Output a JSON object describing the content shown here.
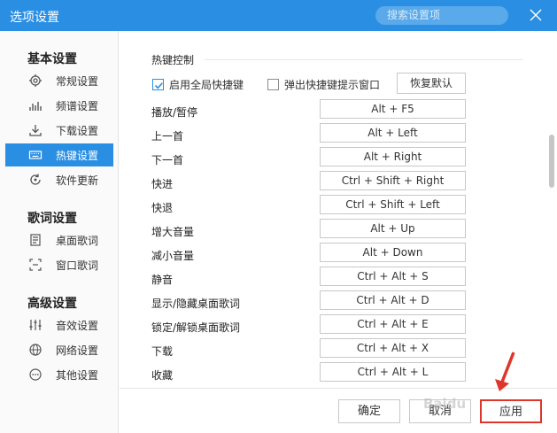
{
  "window": {
    "title": "选项设置"
  },
  "search": {
    "placeholder": "搜索设置项"
  },
  "sidebar": {
    "groups": [
      {
        "title": "基本设置",
        "items": [
          {
            "label": "常规设置",
            "icon": "gear-icon"
          },
          {
            "label": "频谱设置",
            "icon": "spectrum-icon"
          },
          {
            "label": "下载设置",
            "icon": "download-icon"
          },
          {
            "label": "热键设置",
            "icon": "keyboard-icon",
            "active": true
          },
          {
            "label": "软件更新",
            "icon": "refresh-icon"
          }
        ]
      },
      {
        "title": "歌词设置",
        "items": [
          {
            "label": "桌面歌词",
            "icon": "desktop-lyrics-icon"
          },
          {
            "label": "窗口歌词",
            "icon": "window-lyrics-icon"
          }
        ]
      },
      {
        "title": "高级设置",
        "items": [
          {
            "label": "音效设置",
            "icon": "equalizer-icon"
          },
          {
            "label": "网络设置",
            "icon": "globe-icon"
          },
          {
            "label": "其他设置",
            "icon": "more-icon"
          }
        ]
      }
    ]
  },
  "hotkeys": {
    "section_title": "热键控制",
    "enable_global_label": "启用全局快捷键",
    "enable_global_checked": true,
    "popup_hint_label": "弹出快捷键提示窗口",
    "popup_hint_checked": false,
    "restore_label": "恢复默认",
    "rows": [
      {
        "action": "播放/暂停",
        "key": "Alt + F5"
      },
      {
        "action": "上一首",
        "key": "Alt + Left"
      },
      {
        "action": "下一首",
        "key": "Alt + Right"
      },
      {
        "action": "快进",
        "key": "Ctrl + Shift + Right"
      },
      {
        "action": "快退",
        "key": "Ctrl + Shift + Left"
      },
      {
        "action": "增大音量",
        "key": "Alt + Up"
      },
      {
        "action": "减小音量",
        "key": "Alt + Down"
      },
      {
        "action": "静音",
        "key": "Ctrl + Alt + S"
      },
      {
        "action": "显示/隐藏桌面歌词",
        "key": "Ctrl + Alt + D"
      },
      {
        "action": "锁定/解锁桌面歌词",
        "key": "Ctrl + Alt + E"
      },
      {
        "action": "下载",
        "key": "Ctrl + Alt + X"
      },
      {
        "action": "收藏",
        "key": "Ctrl + Alt + L"
      }
    ]
  },
  "footer": {
    "ok_label": "确定",
    "cancel_label": "取消",
    "apply_label": "应用"
  },
  "colors": {
    "accent": "#2a8fe3",
    "highlight": "#e0352b"
  }
}
